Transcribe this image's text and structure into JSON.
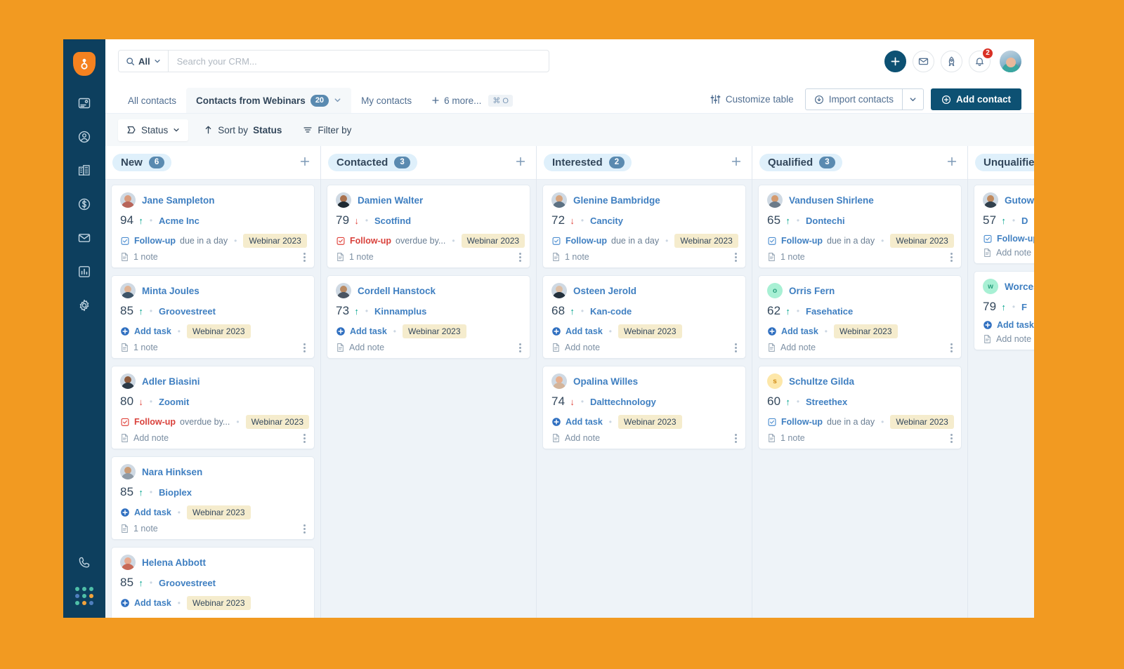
{
  "app": {
    "brand_color": "#f58220",
    "page_bg": "#f29a21",
    "sidebar_bg": "#0d3f5e",
    "accent": "#0d5173"
  },
  "sidebar": {
    "logo_name": "hubspot-sprocket-logo",
    "items": [
      {
        "icon": "contacts-card-icon",
        "label": "Contacts overview"
      },
      {
        "icon": "user-circle-icon",
        "label": "Contacts"
      },
      {
        "icon": "company-building-icon",
        "label": "Companies"
      },
      {
        "icon": "deals-dollar-icon",
        "label": "Deals"
      },
      {
        "icon": "email-envelope-icon",
        "label": "Marketing email"
      },
      {
        "icon": "reports-bar-chart-icon",
        "label": "Reports"
      },
      {
        "icon": "settings-gear-icon",
        "label": "Settings"
      }
    ],
    "bottom_items": [
      {
        "icon": "phone-handset-icon",
        "label": "Calling"
      },
      {
        "icon": "app-grid-icon",
        "label": "Apps"
      }
    ]
  },
  "search": {
    "scope_label": "All",
    "placeholder": "Search your CRM...",
    "value": ""
  },
  "topbar": {
    "create_label": "+",
    "icons": [
      {
        "name": "create-plus-icon"
      },
      {
        "name": "email-envelope-icon"
      },
      {
        "name": "rocket-upgrade-icon"
      },
      {
        "name": "notifications-bell-icon"
      }
    ],
    "notification_count": "2",
    "avatar_name": "user-avatar"
  },
  "tabs": [
    {
      "label": "All contacts",
      "count": null,
      "active": false
    },
    {
      "label": "Contacts from Webinars",
      "count": "20",
      "active": true
    },
    {
      "label": "My contacts",
      "count": null,
      "active": false
    }
  ],
  "more_tabs": {
    "label": "6 more...",
    "shortcut": "⌘ O"
  },
  "actions": {
    "customize_table": "Customize table",
    "import_contacts": "Import contacts",
    "add_contact": "Add contact"
  },
  "filters": {
    "status_label": "Status",
    "sort_prefix": "Sort by",
    "sort_value": "Status",
    "filter_by": "Filter by"
  },
  "board": {
    "columns": [
      {
        "title": "New",
        "count": "6",
        "cards": [
          {
            "name": "Jane Sampleton",
            "score": "94",
            "trend": "up",
            "company": "Acme Inc",
            "task_type": "followup-due",
            "task_label": "Follow-up",
            "task_due": "due in a day",
            "tag": "Webinar 2023",
            "note": "1 note",
            "avatar_kind": "photo",
            "skin": "#d99a7c",
            "cloth": "#b8655a"
          },
          {
            "name": "Minta Joules",
            "score": "85",
            "trend": "up",
            "company": "Groovestreet",
            "task_type": "addtask",
            "task_label": "Add task",
            "task_due": "",
            "tag": "Webinar 2023",
            "note": "1 note",
            "avatar_kind": "photo",
            "skin": "#e0b394",
            "cloth": "#3d5468"
          },
          {
            "name": "Adler Biasini",
            "score": "80",
            "trend": "down",
            "company": "Zoomit",
            "task_type": "followup-overdue",
            "task_label": "Follow-up",
            "task_due": "overdue by...",
            "tag": "Webinar 2023",
            "note": "Add note",
            "avatar_kind": "photo",
            "skin": "#8c5a3c",
            "cloth": "#2c3a47"
          },
          {
            "name": "Nara Hinksen",
            "score": "85",
            "trend": "up",
            "company": "Bioplex",
            "task_type": "addtask",
            "task_label": "Add task",
            "task_due": "",
            "tag": "Webinar 2023",
            "note": "1 note",
            "avatar_kind": "photo",
            "skin": "#c99a74",
            "cloth": "#8e9aa6"
          },
          {
            "name": "Helena Abbott",
            "score": "85",
            "trend": "up",
            "company": "Groovestreet",
            "task_type": "addtask",
            "task_label": "Add task",
            "task_due": "",
            "tag": "Webinar 2023",
            "note": "",
            "avatar_kind": "photo",
            "skin": "#e8a98e",
            "cloth": "#c76a57"
          }
        ]
      },
      {
        "title": "Contacted",
        "count": "3",
        "cards": [
          {
            "name": "Damien Walter",
            "score": "79",
            "trend": "down",
            "company": "Scotfind",
            "task_type": "followup-overdue",
            "task_label": "Follow-up",
            "task_due": "overdue by...",
            "tag": "Webinar 2023",
            "note": "1 note",
            "avatar_kind": "photo",
            "skin": "#a9714d",
            "cloth": "#1f2a33"
          },
          {
            "name": "Cordell Hanstock",
            "score": "73",
            "trend": "up",
            "company": "Kinnamplus",
            "task_type": "addtask",
            "task_label": "Add task",
            "task_due": "",
            "tag": "Webinar 2023",
            "note": "Add note",
            "avatar_kind": "photo",
            "skin": "#b98a63",
            "cloth": "#4a5562"
          }
        ]
      },
      {
        "title": "Interested",
        "count": "2",
        "cards": [
          {
            "name": "Glenine Bambridge",
            "score": "72",
            "trend": "down",
            "company": "Cancity",
            "task_type": "followup-due",
            "task_label": "Follow-up",
            "task_due": "due in a day",
            "tag": "Webinar 2023",
            "note": "1 note",
            "avatar_kind": "photo",
            "skin": "#d7a57f",
            "cloth": "#5c7183"
          },
          {
            "name": "Osteen Jerold",
            "score": "68",
            "trend": "up",
            "company": "Kan-code",
            "task_type": "addtask",
            "task_label": "Add task",
            "task_due": "",
            "tag": "Webinar 2023",
            "note": "Add note",
            "avatar_kind": "photo",
            "skin": "#ddbfa6",
            "cloth": "#24313d"
          },
          {
            "name": "Opalina Willes",
            "score": "74",
            "trend": "down",
            "company": "Dalttechnology",
            "task_type": "addtask",
            "task_label": "Add task",
            "task_due": "",
            "tag": "Webinar 2023",
            "note": "Add note",
            "avatar_kind": "photo",
            "skin": "#e8b08f",
            "cloth": "#d3b49a"
          }
        ]
      },
      {
        "title": "Qualified",
        "count": "3",
        "cards": [
          {
            "name": "Vandusen Shirlene",
            "score": "65",
            "trend": "up",
            "company": "Dontechi",
            "task_type": "followup-due",
            "task_label": "Follow-up",
            "task_due": "due in a day",
            "tag": "Webinar 2023",
            "note": "1 note",
            "avatar_kind": "photo",
            "skin": "#d49a6e",
            "cloth": "#6c7b89"
          },
          {
            "name": "Orris Fern",
            "score": "62",
            "trend": "up",
            "company": "Fasehatice",
            "task_type": "addtask",
            "task_label": "Add task",
            "task_due": "",
            "tag": "Webinar 2023",
            "note": "Add note",
            "avatar_kind": "initial",
            "initial": "o",
            "av_bg": "#a8f0d4",
            "av_fg": "#2a9f7e"
          },
          {
            "name": "Schultze Gilda",
            "score": "60",
            "trend": "up",
            "company": "Streethex",
            "task_type": "followup-due",
            "task_label": "Follow-up",
            "task_due": "due in a day",
            "tag": "Webinar 2023",
            "note": "1 note",
            "avatar_kind": "initial",
            "initial": "s",
            "av_bg": "#fde7a9",
            "av_fg": "#d08b17"
          }
        ]
      },
      {
        "title": "Unqualified",
        "count": "",
        "cards": [
          {
            "name": "Gutowski",
            "score": "57",
            "trend": "up",
            "company": "D",
            "task_type": "followup-due",
            "task_label": "Follow-up",
            "task_due": "",
            "tag": "",
            "note": "Add note",
            "avatar_kind": "photo",
            "skin": "#c08a5e",
            "cloth": "#31404d"
          },
          {
            "name": "Worcester",
            "score": "79",
            "trend": "up",
            "company": "F",
            "task_type": "addtask",
            "task_label": "Add task",
            "task_due": "",
            "tag": "",
            "note": "Add note",
            "avatar_kind": "initial",
            "initial": "w",
            "av_bg": "#a8f0d4",
            "av_fg": "#2a9f7e"
          }
        ]
      }
    ]
  }
}
